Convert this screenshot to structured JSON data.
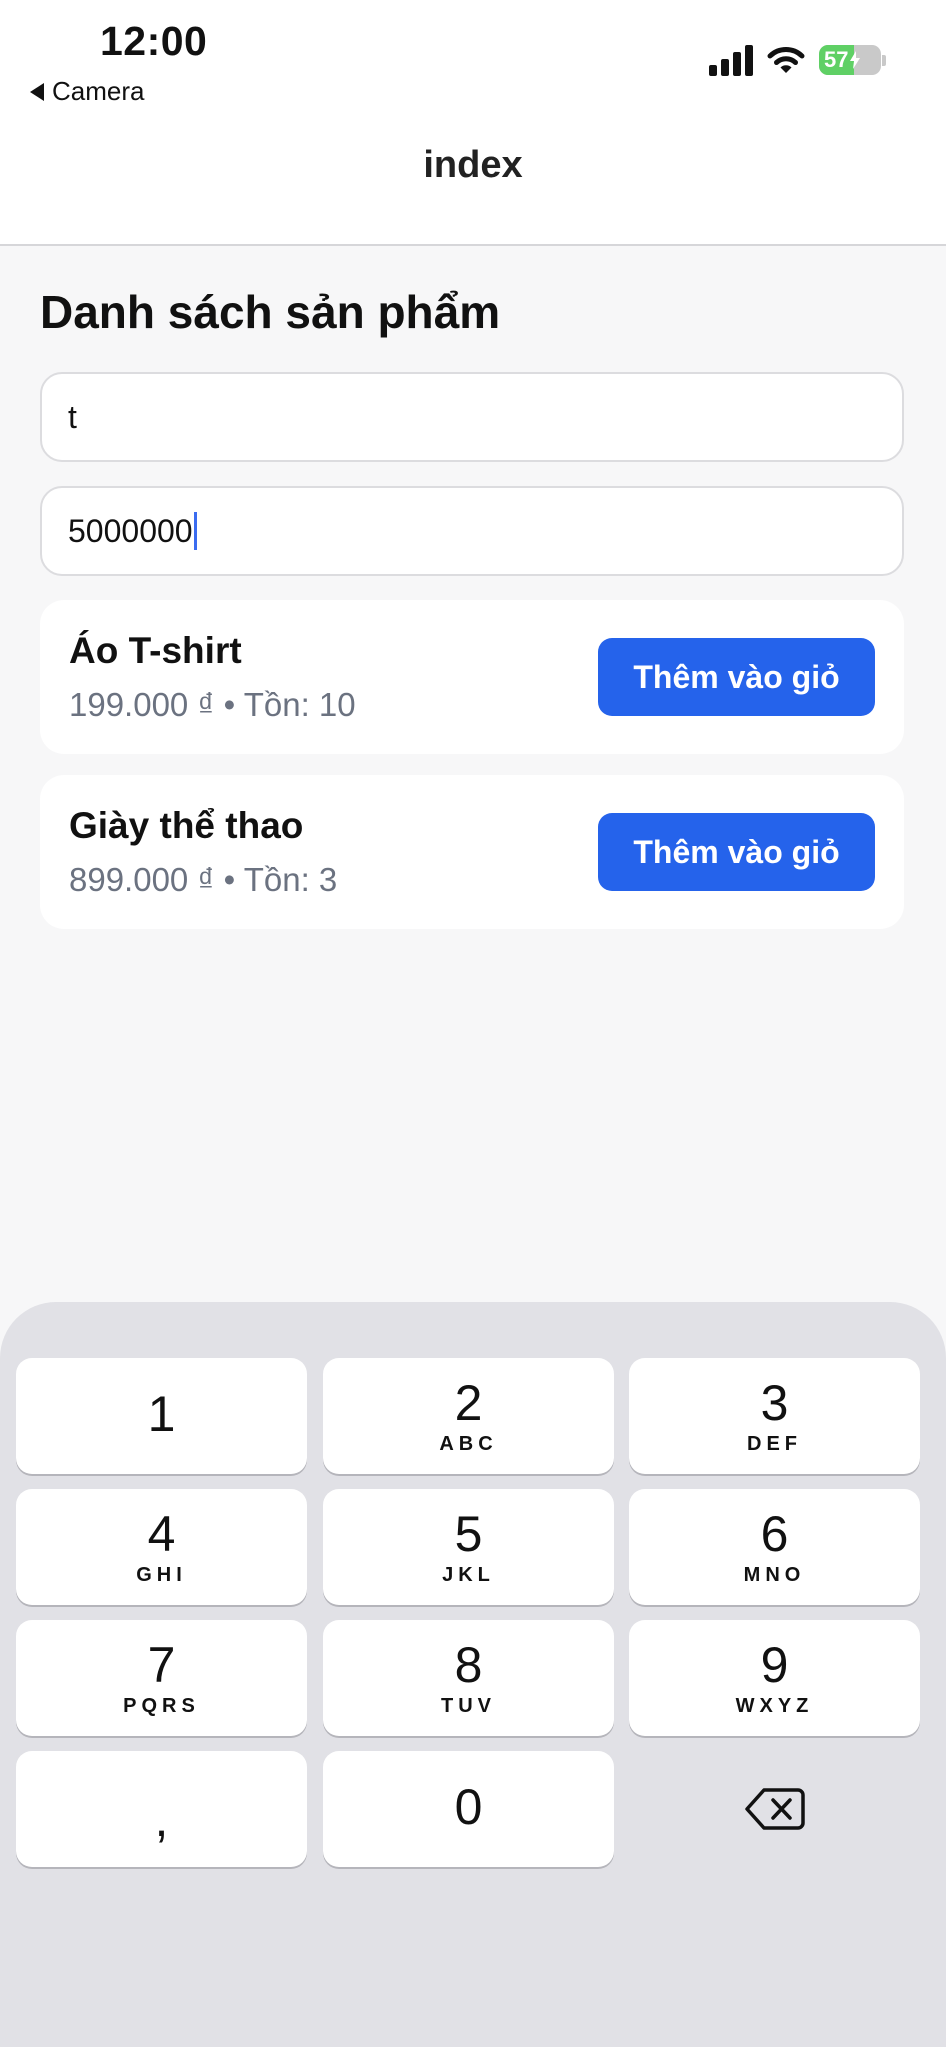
{
  "status_bar": {
    "time": "12:00",
    "back_label": "Camera",
    "battery_level": "57",
    "icons": [
      "signal-icon",
      "wifi-icon",
      "battery-icon"
    ]
  },
  "nav": {
    "title": "index"
  },
  "page": {
    "heading": "Danh sách sản phẩm",
    "name_filter_value": "t",
    "price_filter_value": "5000000"
  },
  "products": [
    {
      "name": "Áo T-shirt",
      "price": "199.000 ₫",
      "stock": "Tồn: 10",
      "button": "Thêm vào giỏ"
    },
    {
      "name": "Giày thể thao",
      "price": "899.000 ₫",
      "stock": "Tồn: 3",
      "button": "Thêm vào giỏ"
    }
  ],
  "separator": "•",
  "keyboard": {
    "keys": [
      {
        "digit": "1",
        "letters": ""
      },
      {
        "digit": "2",
        "letters": "ABC"
      },
      {
        "digit": "3",
        "letters": "DEF"
      },
      {
        "digit": "4",
        "letters": "GHI"
      },
      {
        "digit": "5",
        "letters": "JKL"
      },
      {
        "digit": "6",
        "letters": "MNO"
      },
      {
        "digit": "7",
        "letters": "PQRS"
      },
      {
        "digit": "8",
        "letters": "TUV"
      },
      {
        "digit": "9",
        "letters": "WXYZ"
      },
      {
        "digit": ",",
        "letters": ""
      },
      {
        "digit": "0",
        "letters": ""
      }
    ],
    "delete_icon": "delete-backspace-icon"
  },
  "colors": {
    "accent": "#2563eb",
    "battery_green": "#5fd065",
    "bottom_button": "#9ed8c4"
  }
}
